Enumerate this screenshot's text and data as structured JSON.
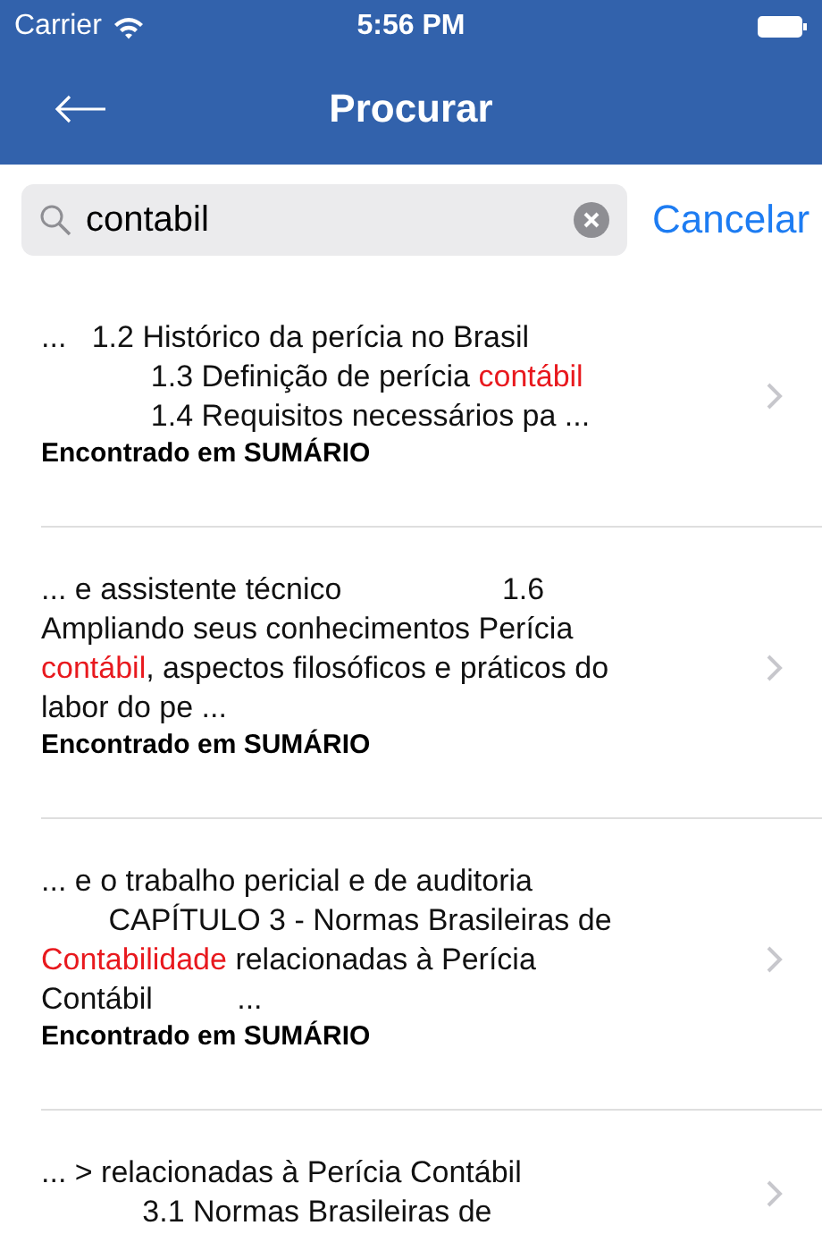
{
  "status_bar": {
    "carrier": "Carrier",
    "time": "5:56 PM"
  },
  "nav": {
    "title": "Procurar"
  },
  "search": {
    "value": "contabil",
    "cancel": "Cancelar"
  },
  "results": [
    {
      "lines": [
        [
          {
            "text": "...   1.2 Histórico da perícia no Brasil",
            "highlight": false
          }
        ],
        [
          {
            "text": "             1.3 Definição de perícia ",
            "highlight": false
          },
          {
            "text": "contábil",
            "highlight": true
          }
        ],
        [
          {
            "text": "             1.4 Requisitos necessários pa ...",
            "highlight": false
          }
        ]
      ],
      "source": "Encontrado em SUMÁRIO"
    },
    {
      "lines": [
        [
          {
            "text": "... e assistente técnico                   1.6",
            "highlight": false
          }
        ],
        [
          {
            "text": "Ampliando seus conhecimentos Perícia",
            "highlight": false
          }
        ],
        [
          {
            "text": "contábil",
            "highlight": true
          },
          {
            "text": ", aspectos filosóficos e práticos do",
            "highlight": false
          }
        ],
        [
          {
            "text": "labor do pe ...",
            "highlight": false
          }
        ]
      ],
      "source": "Encontrado em SUMÁRIO"
    },
    {
      "lines": [
        [
          {
            "text": "... e o trabalho pericial e de auditoria",
            "highlight": false
          }
        ],
        [
          {
            "text": "        CAPÍTULO 3 - Normas Brasileiras de",
            "highlight": false
          }
        ],
        [
          {
            "text": "Contabilidade",
            "highlight": true
          },
          {
            "text": " relacionadas à Perícia",
            "highlight": false
          }
        ],
        [
          {
            "text": "Contábil          ...",
            "highlight": false
          }
        ]
      ],
      "source": "Encontrado em SUMÁRIO"
    },
    {
      "lines": [
        [
          {
            "text": "... > relacionadas à Perícia Contábil",
            "highlight": false
          }
        ],
        [
          {
            "text": "            3.1 Normas Brasileiras de",
            "highlight": false
          }
        ]
      ]
    }
  ]
}
